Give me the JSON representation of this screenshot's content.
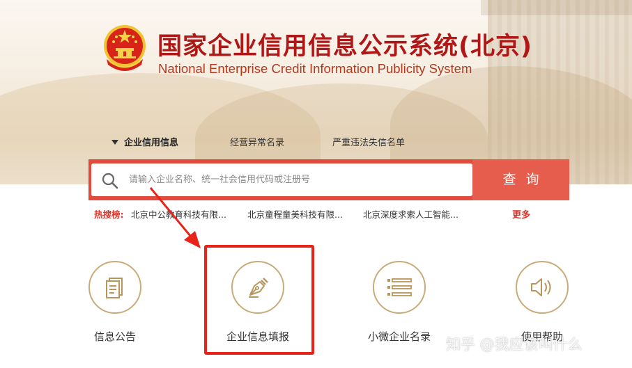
{
  "header": {
    "title_cn": "国家企业信用信息公示系统(北京)",
    "title_en": "National Enterprise Credit Information Publicity System",
    "emblem_icon": "national-emblem-icon"
  },
  "tabs": [
    {
      "label": "企业信用信息",
      "active": true
    },
    {
      "label": "经营异常名录",
      "active": false
    },
    {
      "label": "严重违法失信名单",
      "active": false
    }
  ],
  "search": {
    "placeholder": "请输入企业名称、统一社会信用代码或注册号",
    "button_label": "查询",
    "icon": "search-icon"
  },
  "hot_search": {
    "label": "热搜榜:",
    "items": [
      "北京中公教育科技有限...",
      "北京童程童美科技有限...",
      "北京深度求索人工智能..."
    ],
    "more_label": "更多"
  },
  "features": [
    {
      "label": "信息公告",
      "icon": "document-icon"
    },
    {
      "label": "企业信息填报",
      "icon": "pen-nib-icon",
      "highlighted": true
    },
    {
      "label": "小微企业名录",
      "icon": "list-icon"
    },
    {
      "label": "使用帮助",
      "icon": "speaker-icon"
    }
  ],
  "watermark": "知乎 @我应该叫什么",
  "colors": {
    "brand_red": "#b01818",
    "search_bar": "#e24a3b",
    "icon_gold": "#c9ab79",
    "highlight_red": "#e8231a"
  }
}
